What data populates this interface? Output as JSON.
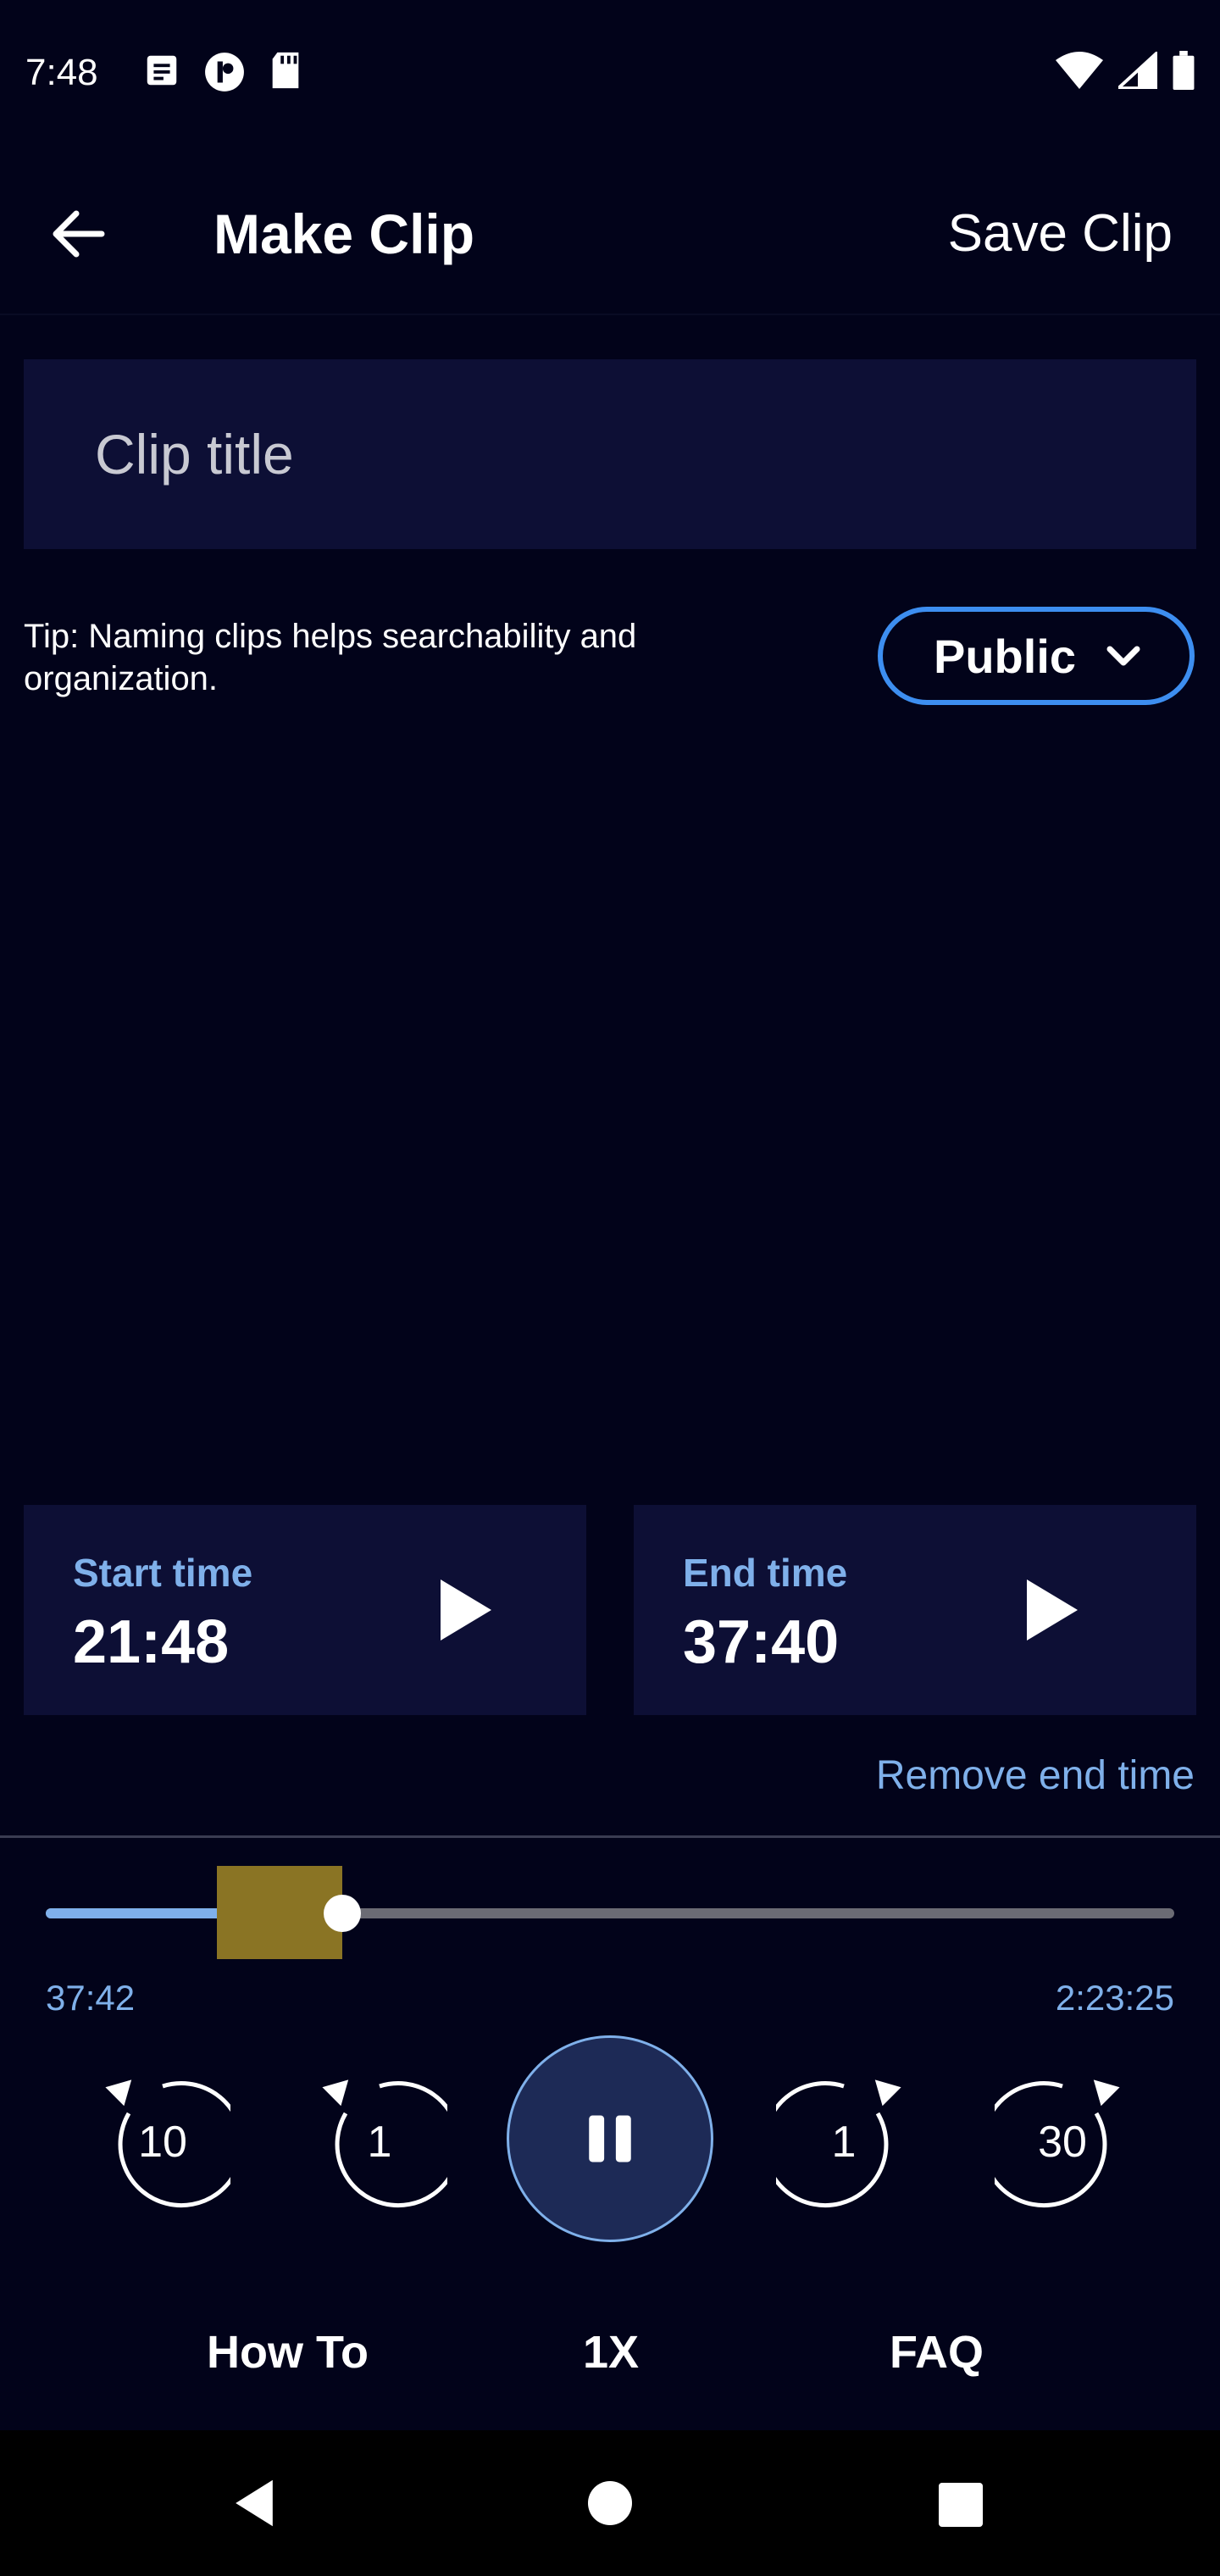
{
  "status_bar": {
    "time": "7:48",
    "left_icons": [
      "notes-icon",
      "podcast-app-icon",
      "sd-card-icon"
    ],
    "right_icons": [
      "wifi-icon",
      "signal-icon",
      "battery-icon"
    ]
  },
  "header": {
    "title": "Make Clip",
    "save_label": "Save Clip",
    "back_icon": "arrow-left-icon"
  },
  "form": {
    "clip_title_placeholder": "Clip title",
    "clip_title_value": "",
    "tip": "Tip: Naming clips helps searchability and organization.",
    "visibility": "Public"
  },
  "times": {
    "start_label": "Start time",
    "start_value": "21:48",
    "end_label": "End time",
    "end_value": "37:40",
    "remove_end_label": "Remove end time"
  },
  "player": {
    "current_time": "37:42",
    "duration": "2:23:25",
    "progress_fraction": 0.263,
    "clip_start_fraction": 0.152,
    "clip_end_fraction": 0.263,
    "rewind_10_label": "10",
    "rewind_1_label": "1",
    "forward_1_label": "1",
    "forward_30_label": "30",
    "state": "playing"
  },
  "footer": {
    "how_to": "How To",
    "speed": "1X",
    "faq": "FAQ"
  },
  "colors": {
    "background": "#02031a",
    "card": "#0d0f35",
    "accent": "#3d8ef0",
    "label_blue": "#7fb0ea",
    "clip_marker": "#8a7424"
  }
}
